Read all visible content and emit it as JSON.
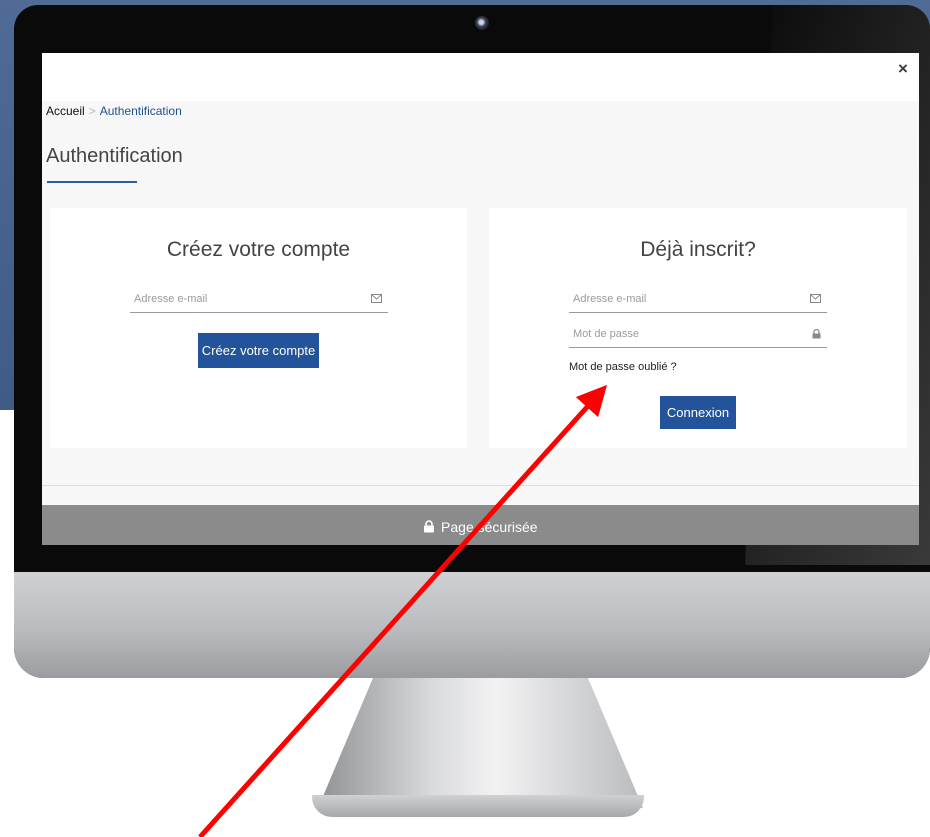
{
  "header": {
    "close_label": "×"
  },
  "breadcrumb": {
    "home": "Accueil",
    "separator": ">",
    "current": "Authentification"
  },
  "page": {
    "title": "Authentification"
  },
  "create_account": {
    "title": "Créez votre compte",
    "email_placeholder": "Adresse e-mail",
    "email_icon": "envelope-icon",
    "button_label": "Créez votre compte"
  },
  "login": {
    "title": "Déjà inscrit?",
    "email_placeholder": "Adresse e-mail",
    "email_icon": "envelope-icon",
    "password_placeholder": "Mot de passe",
    "password_icon": "lock-icon",
    "forgot_label": "Mot de passe oublié ?",
    "button_label": "Connexion"
  },
  "footer": {
    "secure_label": "Page sécurisée",
    "secure_icon": "lock-icon"
  },
  "colors": {
    "accent": "#22539b",
    "annotation_arrow": "#ff0000",
    "secure_bar": "#8b8b8b"
  }
}
